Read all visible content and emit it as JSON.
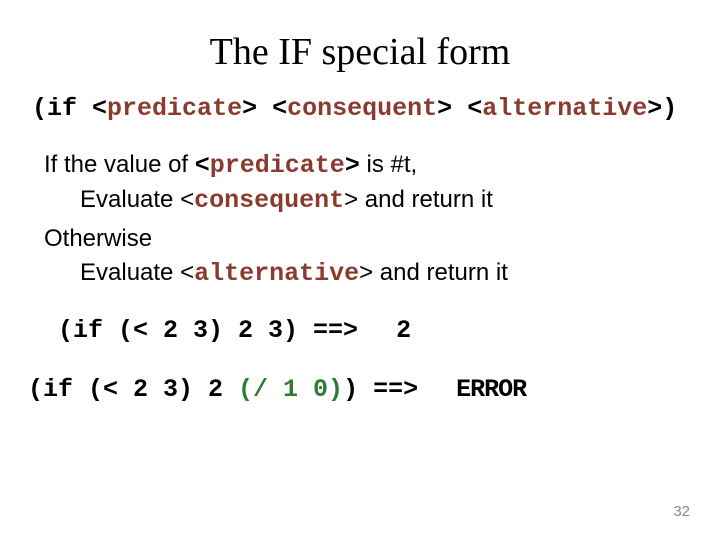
{
  "title": "The IF special form",
  "syntax": {
    "open": "(",
    "if": "if ",
    "lt1": "<",
    "predicate": "predicate",
    "gt1": ">",
    "sp1": " ",
    "lt2": "<",
    "consequent": "consequent",
    "gt2": ">",
    "sp2": " ",
    "lt3": "<",
    "alternative": "alternative",
    "gt3": ">",
    "close": ")"
  },
  "desc": {
    "l1a": "If the value of ",
    "l1_lt": "<",
    "l1_pred": "predicate",
    "l1_gt": ">",
    "l1b": " is #t,",
    "l2a": "Evaluate ",
    "l2_lt": "<",
    "l2_cons": "consequent",
    "l2_gt": ">",
    "l2b": "  and return it",
    "l3": "Otherwise",
    "l4a": "Evaluate ",
    "l4_lt": "<",
    "l4_alt": "alternative",
    "l4_gt": ">",
    "l4b": "  and return it"
  },
  "ex1": {
    "code": "(if (< 2 3) 2 3) ==>",
    "result": "2"
  },
  "ex2": {
    "pre": "(if (< 2 3) 2 ",
    "div": "(/ 1 0)",
    "post": ") ==>",
    "result": "ERROR"
  },
  "page": "32"
}
